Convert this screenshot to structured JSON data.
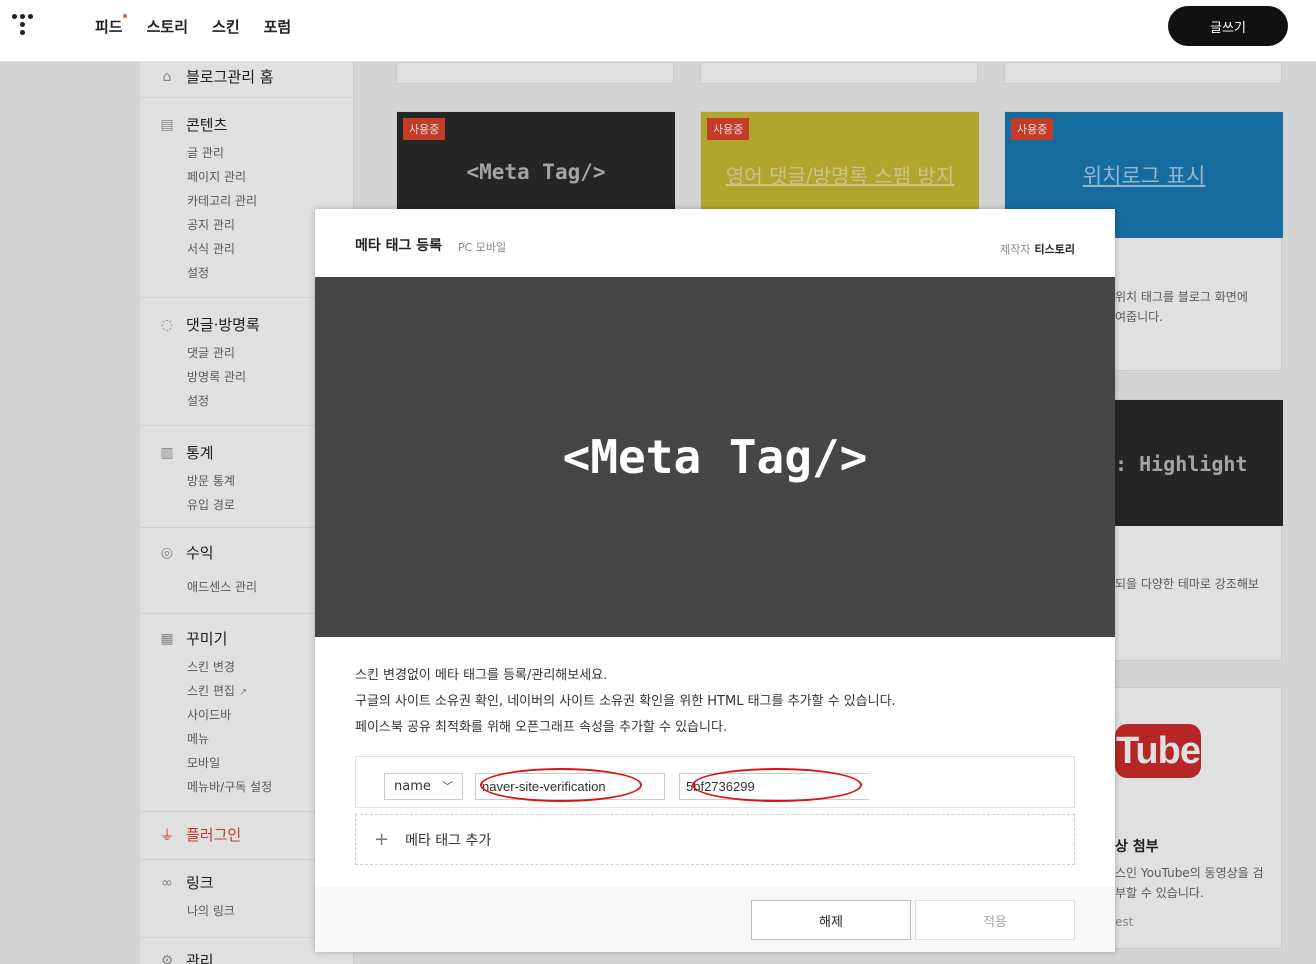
{
  "topbar": {
    "nav": [
      "피드",
      "스토리",
      "스킨",
      "포럼"
    ],
    "write_label": "글쓰기"
  },
  "sidebar": {
    "home": "블로그관리 홈",
    "contents": {
      "title": "콘텐츠",
      "items": [
        "글 관리",
        "페이지 관리",
        "카테고리 관리",
        "공지 관리",
        "서식 관리",
        "설정"
      ]
    },
    "comments": {
      "title": "댓글·방명록",
      "items": [
        "댓글 관리",
        "방명록 관리",
        "설정"
      ]
    },
    "stats": {
      "title": "통계",
      "items": [
        "방문 통계",
        "유입 경로"
      ]
    },
    "revenue": {
      "title": "수익",
      "items": [
        "애드센스 관리"
      ]
    },
    "design": {
      "title": "꾸미기",
      "items": [
        "스킨 변경",
        "스킨 편집",
        "사이드바",
        "메뉴",
        "모바일",
        "메뉴바/구독 설정"
      ]
    },
    "plugin": {
      "title": "플러그인"
    },
    "link": {
      "title": "링크",
      "items": [
        "나의 링크"
      ]
    },
    "manage": {
      "title": "관리"
    }
  },
  "cards": {
    "badge": "사용중",
    "card1_title": "<Meta Tag/>",
    "card2_title": "영어 댓글/방명록 스팸 방지",
    "card3_title": "위치로그 표시",
    "card3_desc": [
      "위치 태그를 블로그 화면에",
      "여줍니다."
    ],
    "card6_title": "Highlight",
    "card6_desc": "되을 다양한 테마로 강조해보",
    "card9_title": "상 첨부",
    "card9_desc": [
      "스인 YouTube의 동영상을 검",
      "부할 수 있습니다."
    ],
    "card9_note": "est",
    "youtube": "Tube"
  },
  "modal": {
    "title": "메타 태그 등록",
    "subtitle": "PC 모바일",
    "maker_label": "제작자",
    "maker_name": "티스토리",
    "preview_text": "<Meta Tag/>",
    "desc": [
      "스킨 변경없이 메타 태그를 등록/관리해보세요.",
      "구글의 사이트 소유권 확인, 네이버의 사이트 소유권 확인을 위한 HTML 태그를 추가할 수 있습니다.",
      "페이스북 공유 최적화를 위해 오픈그래프 속성을 추가할 수 있습니다."
    ],
    "select_value": "name",
    "name_input": "naver-site-verification",
    "content_input": "5bf2736299",
    "add_label": "메타 태그 추가",
    "release_label": "해제",
    "apply_label": "적용"
  }
}
